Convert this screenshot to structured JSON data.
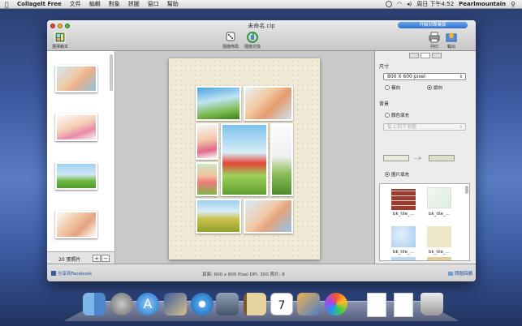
{
  "menubar": {
    "app": "Collagelt Free",
    "items": [
      "文件",
      "編輯",
      "對象",
      "拼圖",
      "窗口",
      "幫助"
    ],
    "clock": "周日 下午4:52",
    "user": "Pearlmountain"
  },
  "window": {
    "title": "未命名.cip",
    "upgrade_label": "升級到專業版",
    "toolbar": {
      "template_label": "選擇範本",
      "random_label": "隨機佈局",
      "shuffle_label": "隨機交換",
      "print_label": "列印",
      "export_label": "輸出"
    }
  },
  "sidebar": {
    "count_label": "20 張照片",
    "add_label": "+",
    "remove_label": "−"
  },
  "inspector": {
    "size_label": "尺寸",
    "size_value": "800 X 600 pixel",
    "landscape_label": "橫向",
    "portrait_label": "縱向",
    "background_label": "背景",
    "color_fill_label": "顏色填充",
    "gradient_value": "從上到下漸變",
    "arrow_label": "-->",
    "image_fill_label": "圖片填充",
    "tiles": [
      "bk_tile_...",
      "bk_tile_...",
      "bk_tile_...",
      "bk_tile_..."
    ]
  },
  "status": {
    "share_label": "分享到Facebook",
    "info": "頁面: 600 x 800 Pixel  DPI: 300  照片: 8",
    "help_label": "問題回饋"
  },
  "colors": {
    "accent": "#2e6fd0",
    "paper": "#f0ebd6"
  },
  "dock": {
    "icons": [
      "finder-icon",
      "launchpad-icon",
      "app-store-icon",
      "mail-stamp-icon",
      "safari-icon",
      "facetime-icon",
      "address-book-icon",
      "calendar-icon",
      "iphoto-icon",
      "collageit-icon",
      "document-icon",
      "document-icon",
      "trash-icon"
    ],
    "calendar_day": "7"
  }
}
